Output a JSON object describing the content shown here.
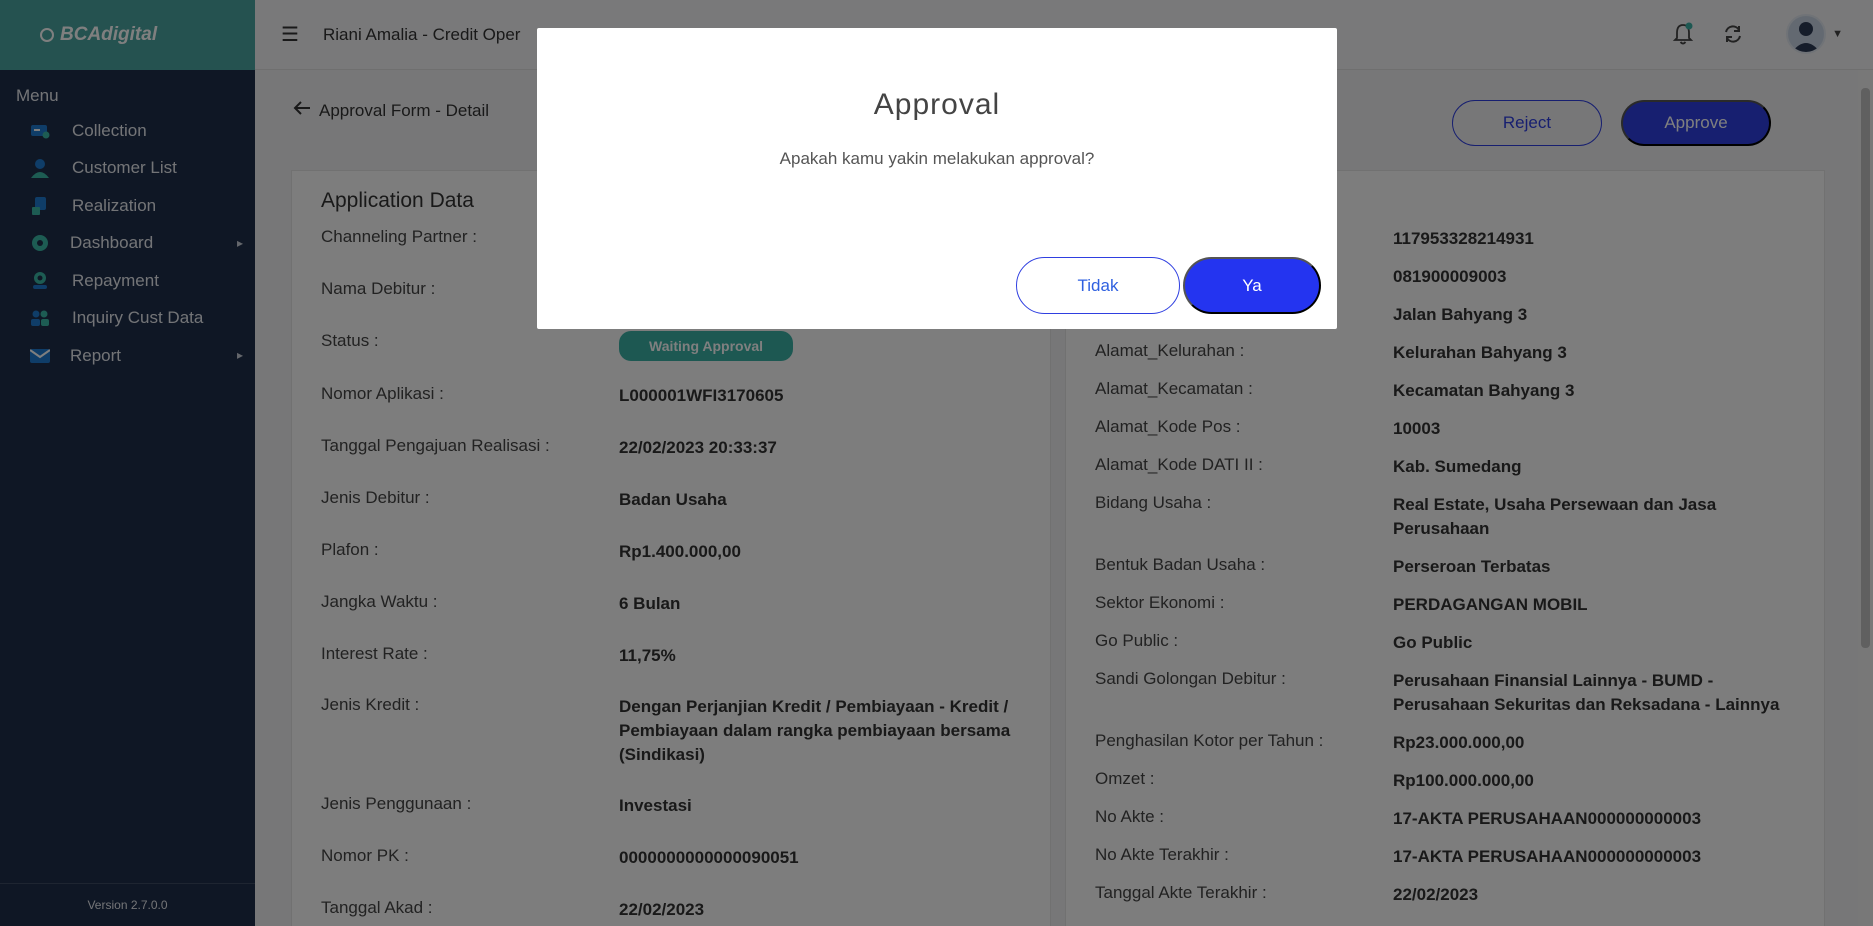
{
  "sidebar": {
    "logo": "BCAdigital",
    "menu_title": "Menu",
    "items": [
      {
        "label": "Collection",
        "icon": "collection-icon"
      },
      {
        "label": "Customer List",
        "icon": "user-icon"
      },
      {
        "label": "Realization",
        "icon": "realization-icon"
      },
      {
        "label": "Dashboard",
        "icon": "dashboard-icon",
        "has_submenu": true
      },
      {
        "label": "Repayment",
        "icon": "repayment-icon"
      },
      {
        "label": "Inquiry Cust Data",
        "icon": "inquiry-icon"
      },
      {
        "label": "Report",
        "icon": "mail-icon",
        "has_submenu": true
      }
    ],
    "version": "Version 2.7.0.0"
  },
  "header": {
    "title": "Riani Amalia - Credit Oper",
    "icons": [
      "hamburger-icon",
      "bell-icon",
      "refresh-icon",
      "avatar"
    ]
  },
  "page": {
    "back_label": "Approval Form - Detail",
    "reject_label": "Reject",
    "approve_label": "Approve"
  },
  "left_card": {
    "title": "Application Data",
    "rows": [
      {
        "label": "Channeling Partner :",
        "value": ""
      },
      {
        "label": "Nama Debitur :",
        "value": ""
      },
      {
        "label": "Status :",
        "value": "Waiting Approval"
      },
      {
        "label": "Nomor Aplikasi :",
        "value": "L000001WFI3170605"
      },
      {
        "label": "Tanggal Pengajuan Realisasi :",
        "value": "22/02/2023 20:33:37"
      },
      {
        "label": "Jenis Debitur :",
        "value": "Badan Usaha"
      },
      {
        "label": "Plafon :",
        "value": "Rp1.400.000,00"
      },
      {
        "label": "Jangka Waktu :",
        "value": "6 Bulan"
      },
      {
        "label": "Interest Rate :",
        "value": "11,75%"
      },
      {
        "label": "Jenis Kredit :",
        "value": "Dengan Perjanjian Kredit / Pembiayaan - Kredit / Pembiayaan dalam rangka pembiayaan bersama (Sindikasi)"
      },
      {
        "label": "Jenis Penggunaan :",
        "value": "Investasi"
      },
      {
        "label": "Nomor PK :",
        "value": "0000000000000090051"
      },
      {
        "label": "Tanggal Akad :",
        "value": "22/02/2023"
      }
    ]
  },
  "right_card": {
    "rows": [
      {
        "label": "",
        "value": "117953328214931"
      },
      {
        "label": "",
        "value": "081900009003"
      },
      {
        "label": "",
        "value": "Jalan Bahyang 3"
      },
      {
        "label": "Alamat_Kelurahan :",
        "value": "Kelurahan Bahyang 3"
      },
      {
        "label": "Alamat_Kecamatan :",
        "value": "Kecamatan Bahyang 3"
      },
      {
        "label": "Alamat_Kode Pos :",
        "value": "10003"
      },
      {
        "label": "Alamat_Kode DATI II :",
        "value": "Kab. Sumedang"
      },
      {
        "label": "Bidang Usaha :",
        "value": "Real Estate, Usaha Persewaan dan Jasa Perusahaan"
      },
      {
        "label": "Bentuk Badan Usaha :",
        "value": "Perseroan Terbatas"
      },
      {
        "label": "Sektor Ekonomi :",
        "value": "PERDAGANGAN MOBIL"
      },
      {
        "label": "Go Public :",
        "value": "Go Public"
      },
      {
        "label": "Sandi Golongan Debitur :",
        "value": "Perusahaan Finansial Lainnya - BUMD - Perusahaan Sekuritas dan Reksadana - Lainnya"
      },
      {
        "label": "Penghasilan Kotor per Tahun :",
        "value": "Rp23.000.000,00"
      },
      {
        "label": "Omzet :",
        "value": "Rp100.000.000,00"
      },
      {
        "label": "No Akte :",
        "value": "17-AKTA PERUSAHAAN000000000003"
      },
      {
        "label": "No Akte Terakhir :",
        "value": "17-AKTA PERUSAHAAN000000000003"
      },
      {
        "label": "Tanggal Akte Terakhir :",
        "value": "22/02/2023"
      }
    ]
  },
  "modal": {
    "title": "Approval",
    "message": "Apakah kamu yakin melakukan approval?",
    "cancel_label": "Tidak",
    "confirm_label": "Ya"
  },
  "colors": {
    "sidebar_bg": "#1f2f4a",
    "logo_bg": "#4aa5a0",
    "primary": "#2f3fe0",
    "status_badge": "#3ab0a4"
  }
}
